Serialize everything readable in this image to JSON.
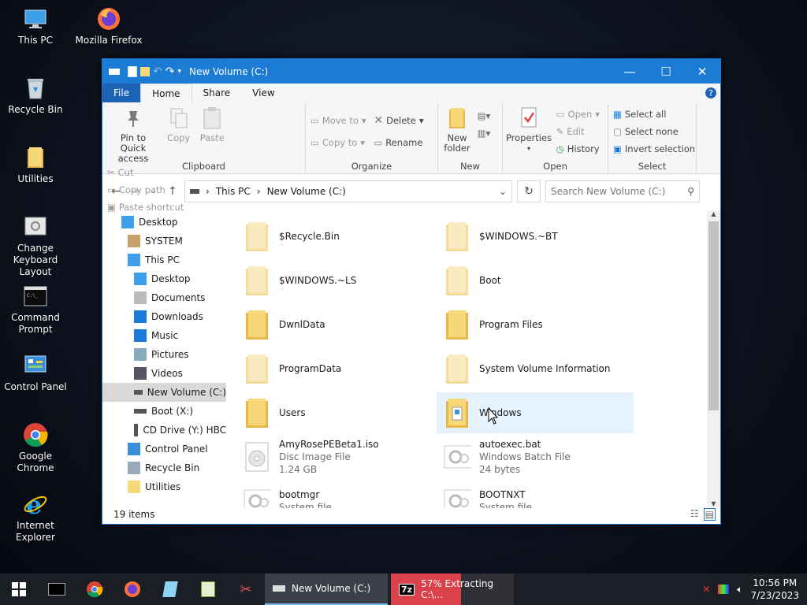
{
  "desktop": {
    "icons": [
      {
        "label": "This PC",
        "icon": "this-pc-icon"
      },
      {
        "label": "Mozilla Firefox",
        "icon": "firefox-icon"
      },
      {
        "label": "Recycle Bin",
        "icon": "recycle-bin-icon"
      },
      {
        "label": "Utilities",
        "icon": "folder-icon"
      },
      {
        "label": "Change Keyboard Layout",
        "icon": "keyboard-layout-icon"
      },
      {
        "label": "Command Prompt",
        "icon": "command-prompt-icon"
      },
      {
        "label": "Control Panel",
        "icon": "control-panel-icon"
      },
      {
        "label": "Google Chrome",
        "icon": "chrome-icon"
      },
      {
        "label": "Internet Explorer",
        "icon": "internet-explorer-icon"
      }
    ]
  },
  "window": {
    "title": "New Volume (C:)",
    "tabs": [
      "File",
      "Home",
      "Share",
      "View"
    ],
    "ribbon": {
      "clipboard": {
        "group": "Clipboard",
        "pin": "Pin to Quick access",
        "copy": "Copy",
        "paste": "Paste",
        "cut": "Cut",
        "copy_path": "Copy path",
        "paste_shortcut": "Paste shortcut"
      },
      "organize": {
        "group": "Organize",
        "move_to": "Move to",
        "copy_to": "Copy to",
        "delete": "Delete",
        "rename": "Rename"
      },
      "new": {
        "group": "New",
        "new_folder": "New folder"
      },
      "open": {
        "group": "Open",
        "properties": "Properties",
        "open": "Open",
        "edit": "Edit",
        "history": "History"
      },
      "select": {
        "group": "Select",
        "select_all": "Select all",
        "select_none": "Select none",
        "invert": "Invert selection"
      }
    },
    "address": {
      "root": "This PC",
      "current": "New Volume (C:)",
      "search_placeholder": "Search New Volume (C:)"
    },
    "nav_items": [
      {
        "label": "Desktop",
        "indent": 0
      },
      {
        "label": "SYSTEM",
        "indent": 1
      },
      {
        "label": "This PC",
        "indent": 1
      },
      {
        "label": "Desktop",
        "indent": 2
      },
      {
        "label": "Documents",
        "indent": 2
      },
      {
        "label": "Downloads",
        "indent": 2
      },
      {
        "label": "Music",
        "indent": 2
      },
      {
        "label": "Pictures",
        "indent": 2
      },
      {
        "label": "Videos",
        "indent": 2
      },
      {
        "label": "New Volume (C:)",
        "indent": 2
      },
      {
        "label": "Boot (X:)",
        "indent": 2
      },
      {
        "label": "CD Drive (Y:) HBC",
        "indent": 2
      },
      {
        "label": "Control Panel",
        "indent": 1
      },
      {
        "label": "Recycle Bin",
        "indent": 1
      },
      {
        "label": "Utilities",
        "indent": 1
      }
    ],
    "files": [
      {
        "name": "$Recycle.Bin",
        "type": "",
        "size": "",
        "kind": "folder-faded"
      },
      {
        "name": "$WINDOWS.~BT",
        "type": "",
        "size": "",
        "kind": "folder-faded"
      },
      {
        "name": "$WINDOWS.~LS",
        "type": "",
        "size": "",
        "kind": "folder-faded"
      },
      {
        "name": "Boot",
        "type": "",
        "size": "",
        "kind": "folder-faded"
      },
      {
        "name": "DwnlData",
        "type": "",
        "size": "",
        "kind": "folder"
      },
      {
        "name": "Program Files",
        "type": "",
        "size": "",
        "kind": "folder"
      },
      {
        "name": "ProgramData",
        "type": "",
        "size": "",
        "kind": "folder-faded"
      },
      {
        "name": "System Volume Information",
        "type": "",
        "size": "",
        "kind": "folder-faded"
      },
      {
        "name": "Users",
        "type": "",
        "size": "",
        "kind": "folder"
      },
      {
        "name": "Windows",
        "type": "",
        "size": "",
        "kind": "folder-windows"
      },
      {
        "name": "AmyRosePEBeta1.iso",
        "type": "Disc Image File",
        "size": "1.24 GB",
        "kind": "disc"
      },
      {
        "name": "autoexec.bat",
        "type": "Windows Batch File",
        "size": "24 bytes",
        "kind": "gear"
      },
      {
        "name": "bootmgr",
        "type": "System file",
        "size": "",
        "kind": "gear"
      },
      {
        "name": "BOOTNXT",
        "type": "System file",
        "size": "",
        "kind": "gear"
      }
    ],
    "status": {
      "count": "19 items"
    }
  },
  "taskbar": {
    "explorer_window": "New Volume (C:)",
    "extract_window": "57% Extracting C:\\...",
    "extract_progress": 0.57,
    "time": "10:56 PM",
    "date": "7/23/2023"
  },
  "colors": {
    "titlebar": "#1c7cd5",
    "selection": "#e5f3ff",
    "folder": "#f3c85a",
    "progress": "#d9424a"
  }
}
